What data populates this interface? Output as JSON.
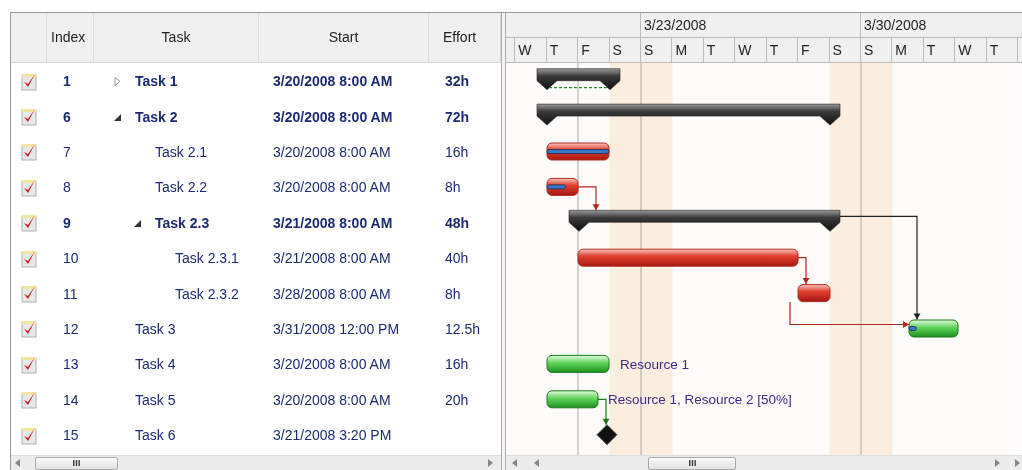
{
  "grid": {
    "columns": [
      "Index",
      "Task",
      "Start",
      "Effort"
    ]
  },
  "tasks": [
    {
      "index": "1",
      "name": "Task 1",
      "start": "3/20/2008 8:00 AM",
      "effort": "32h",
      "kind": "summary",
      "expanded": false
    },
    {
      "index": "6",
      "name": "Task 2",
      "start": "3/20/2008 8:00 AM",
      "effort": "72h",
      "kind": "summary",
      "expanded": true,
      "children": [
        {
          "index": "7",
          "name": "Task 2.1",
          "start": "3/20/2008 8:00 AM",
          "effort": "16h",
          "kind": "task",
          "critical": true,
          "level": 1
        },
        {
          "index": "8",
          "name": "Task 2.2",
          "start": "3/20/2008 8:00 AM",
          "effort": "8h",
          "kind": "task",
          "critical": true,
          "level": 0.6
        },
        {
          "index": "9",
          "name": "Task 2.3",
          "start": "3/21/2008 8:00 AM",
          "effort": "48h",
          "kind": "summary",
          "expanded": true,
          "children": [
            {
              "index": "10",
              "name": "Task 2.3.1",
              "start": "3/21/2008 8:00 AM",
              "effort": "40h",
              "kind": "task",
              "critical": true
            },
            {
              "index": "11",
              "name": "Task 2.3.2",
              "start": "3/28/2008 8:00 AM",
              "effort": "8h",
              "kind": "task",
              "critical": true
            }
          ]
        }
      ]
    },
    {
      "index": "12",
      "name": "Task 3",
      "start": "3/31/2008 12:00 PM",
      "effort": "12.5h",
      "kind": "task",
      "critical": false,
      "level": 0.15
    },
    {
      "index": "13",
      "name": "Task 4",
      "start": "3/20/2008 8:00 AM",
      "effort": "16h",
      "kind": "task",
      "critical": false,
      "resources": "Resource 1"
    },
    {
      "index": "14",
      "name": "Task 5",
      "start": "3/20/2008 8:00 AM",
      "effort": "20h",
      "kind": "task",
      "critical": false,
      "resources": "Resource 1, Resource 2 [50%]"
    },
    {
      "index": "15",
      "name": "Task 6",
      "start": "3/21/2008 3:20 PM",
      "kind": "milestone"
    }
  ],
  "timeline": {
    "weeks": [
      "3/23/2008",
      "3/30/2008"
    ],
    "days": [
      "W",
      "T",
      "F",
      "S",
      "S",
      "M",
      "T",
      "W",
      "T",
      "F",
      "S",
      "S",
      "M",
      "T",
      "W",
      "T"
    ]
  }
}
